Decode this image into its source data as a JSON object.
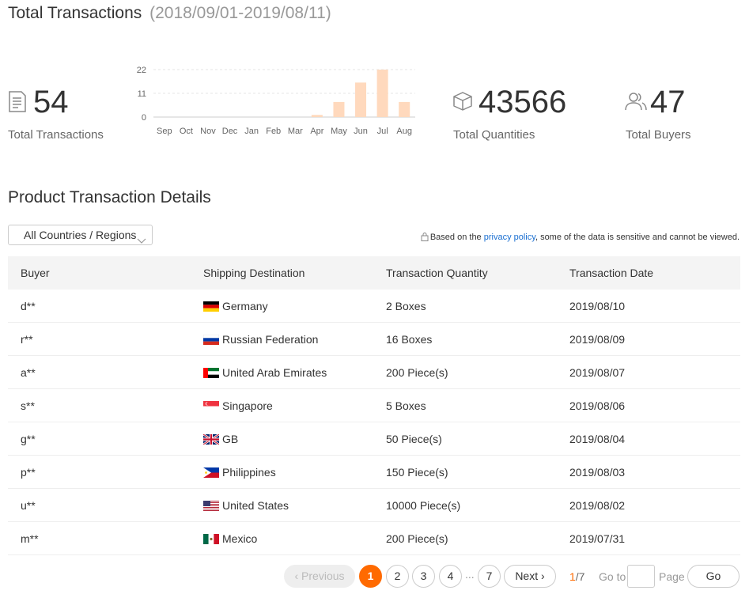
{
  "header": {
    "title": "Total Transactions",
    "range": "(2018/09/01-2019/08/11)"
  },
  "stats": {
    "transactions": {
      "value": "54",
      "label": "Total Transactions",
      "icon": "document-icon"
    },
    "quantities": {
      "value": "43566",
      "label": "Total Quantities",
      "icon": "box-icon"
    },
    "buyers": {
      "value": "47",
      "label": "Total Buyers",
      "icon": "users-icon"
    }
  },
  "chart_data": {
    "type": "bar",
    "categories": [
      "Sep",
      "Oct",
      "Nov",
      "Dec",
      "Jan",
      "Feb",
      "Mar",
      "Apr",
      "May",
      "Jun",
      "Jul",
      "Aug"
    ],
    "values": [
      0,
      0,
      0,
      0,
      0,
      0,
      0,
      1,
      7,
      16,
      22,
      7
    ],
    "yticks": [
      "22",
      "11",
      "0"
    ],
    "ylim": [
      0,
      22
    ],
    "grid": true,
    "color": "#ffd9bd"
  },
  "section": {
    "title": "Product Transaction Details",
    "filter_label": "All Countries / Regions",
    "privacy_prefix": "Based on the ",
    "privacy_link": "privacy policy",
    "privacy_suffix": ", some of the data is sensitive and cannot be viewed."
  },
  "table": {
    "headers": [
      "Buyer",
      "Shipping Destination",
      "Transaction Quantity",
      "Transaction Date"
    ],
    "rows": [
      {
        "buyer": "d**",
        "dest": "Germany",
        "flag": "de",
        "qty": "2 Boxes",
        "date": "2019/08/10"
      },
      {
        "buyer": "r**",
        "dest": "Russian Federation",
        "flag": "ru",
        "qty": "16 Boxes",
        "date": "2019/08/09"
      },
      {
        "buyer": "a**",
        "dest": "United Arab Emirates",
        "flag": "ae",
        "qty": "200 Piece(s)",
        "date": "2019/08/07"
      },
      {
        "buyer": "s**",
        "dest": "Singapore",
        "flag": "sg",
        "qty": "5 Boxes",
        "date": "2019/08/06"
      },
      {
        "buyer": "g**",
        "dest": "GB",
        "flag": "gb",
        "qty": "50 Piece(s)",
        "date": "2019/08/04"
      },
      {
        "buyer": "p**",
        "dest": "Philippines",
        "flag": "ph",
        "qty": "150 Piece(s)",
        "date": "2019/08/03"
      },
      {
        "buyer": "u**",
        "dest": "United States",
        "flag": "us",
        "qty": "10000 Piece(s)",
        "date": "2019/08/02"
      },
      {
        "buyer": "m**",
        "dest": "Mexico",
        "flag": "mx",
        "qty": "200 Piece(s)",
        "date": "2019/07/31"
      }
    ]
  },
  "pagination": {
    "previous": "Previous",
    "pages": [
      "1",
      "2",
      "3",
      "4"
    ],
    "ellipsis": "...",
    "last": "7",
    "next": "Next",
    "current": "1",
    "total": "/7",
    "goto_label": "Go to",
    "page_label": "Page",
    "go": "Go",
    "accent": "#ff6a00"
  }
}
